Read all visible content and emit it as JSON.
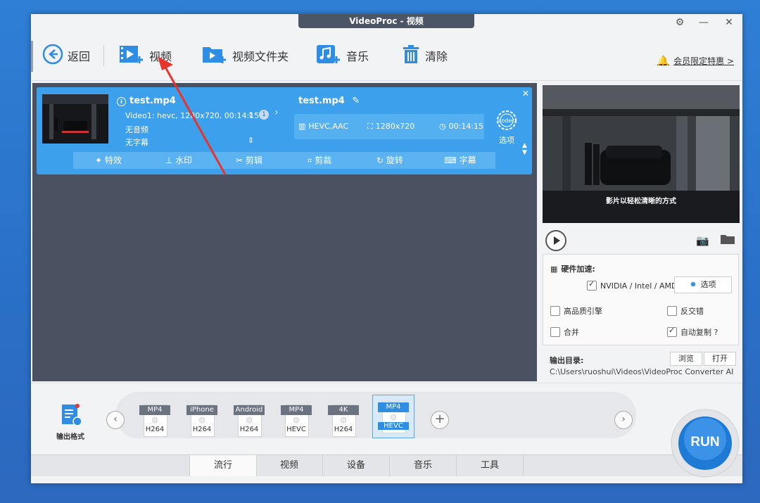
{
  "window": {
    "title": "VideoProc - 视频"
  },
  "toolbar": {
    "back_label": "返回",
    "video_label": "视频",
    "video_folder_label": "视频文件夹",
    "music_label": "音乐",
    "clear_label": "清除",
    "promo_label": "会员限定特惠 >"
  },
  "task": {
    "source_name": "test.mp4",
    "source_info": "Video1: hevc, 1280x720, 00:14:15",
    "audio_info": "无音频",
    "subtitle_info": "无字幕",
    "track_count": "1",
    "output_name": "test.mp4",
    "output_codec": "HEVC,AAC",
    "output_resolution": "1280x720",
    "output_duration": "00:14:15",
    "codec_badge": "codec",
    "codec_options_label": "选项",
    "actions": [
      "特效",
      "水印",
      "剪辑",
      "剪裁",
      "旋转",
      "字幕"
    ]
  },
  "preview": {
    "subtitle": "影片以轻松清晰的方式"
  },
  "settings": {
    "hw_accel_label": "硬件加速:",
    "hw_option": "NVIDIA / Intel / AMD",
    "options_button": "选项",
    "hq_engine": "高品质引擎",
    "deinterlace": "反交错",
    "merge": "合并",
    "auto_copy": "自动复制 ?",
    "hw_option_checked": true,
    "auto_copy_checked": true,
    "hq_engine_checked": false,
    "deinterlace_checked": false,
    "merge_checked": false
  },
  "output_dir": {
    "label": "输出目录:",
    "browse": "浏览",
    "open": "打开",
    "path": "C:\\Users\\ruoshui\\Videos\\VideoProc Converter AI"
  },
  "formats": {
    "side_label": "输出格式",
    "items": [
      {
        "tag": "MP4",
        "codec": "H264"
      },
      {
        "tag": "iPhone",
        "codec": "H264"
      },
      {
        "tag": "Android",
        "codec": "H264"
      },
      {
        "tag": "MP4",
        "codec": "HEVC"
      },
      {
        "tag": "4K",
        "codec": "H264"
      },
      {
        "tag": "MP4",
        "codec": "HEVC"
      }
    ],
    "selected_index": 5
  },
  "tabs": [
    "流行",
    "视频",
    "设备",
    "音乐",
    "工具"
  ],
  "active_tab": "流行",
  "run_label": "RUN",
  "colors": {
    "accent": "#3da0ec",
    "title_tab": "#4b5566",
    "run_button": "#1f7ad6",
    "promo_bell": "#f26b1d"
  }
}
